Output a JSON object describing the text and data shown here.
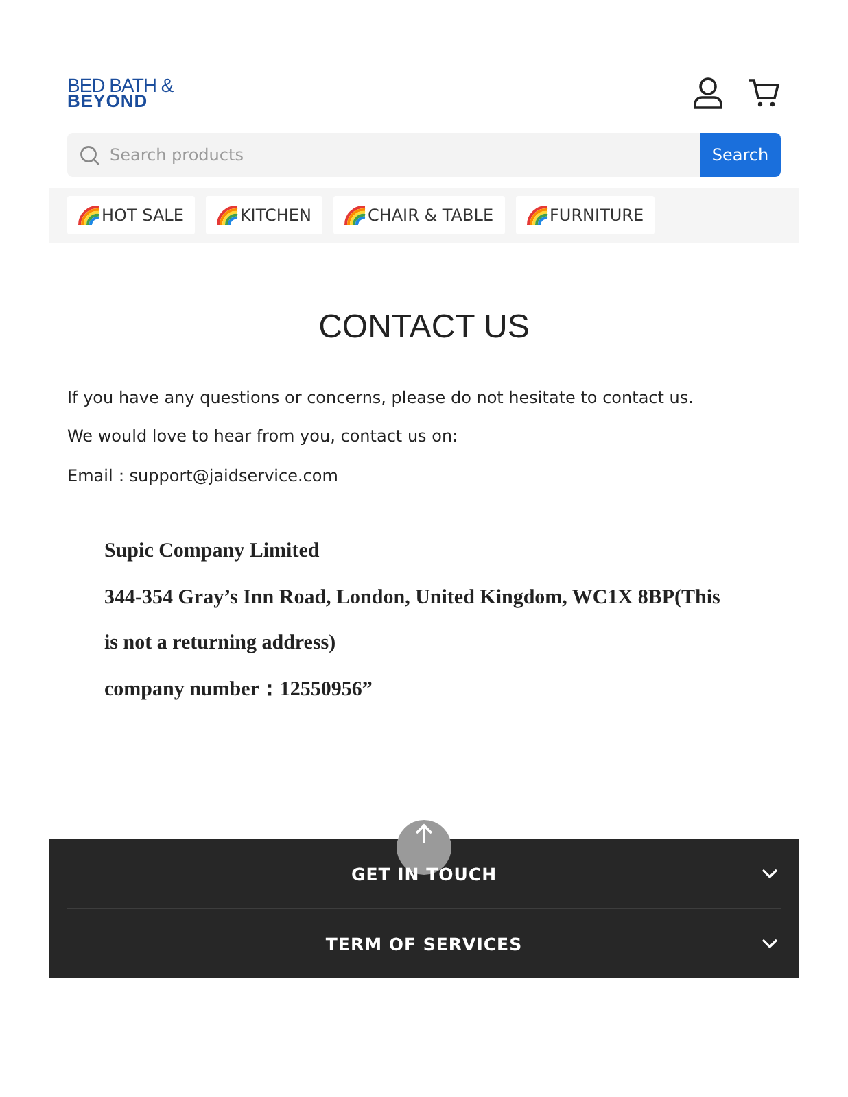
{
  "logo": {
    "line_1": "BED BATH &",
    "line_2": "BEYOND"
  },
  "search": {
    "placeholder": "Search products",
    "button": "Search"
  },
  "categories": [
    {
      "label": "HOT SALE"
    },
    {
      "label": "KITCHEN"
    },
    {
      "label": "CHAIR & TABLE"
    },
    {
      "label": "FURNITURE"
    }
  ],
  "page_title": "CONTACT US",
  "paragraphs": [
    "If you have any questions or concerns, please do not hesitate to contact us.",
    "We would love to hear from you, contact us on:",
    "Email：support@jaidservice.com"
  ],
  "address_lines": [
    "Supic Company Limited",
    "344-354 Gray’s Inn Road, London, United Kingdom, WC1X 8BP(This",
    "is not a returning address)",
    "company number：12550956”"
  ],
  "footer_sections": [
    {
      "label": "GET IN TOUCH",
      "expanded": false
    },
    {
      "label": "TERM OF SERVICES",
      "expanded": false
    }
  ]
}
